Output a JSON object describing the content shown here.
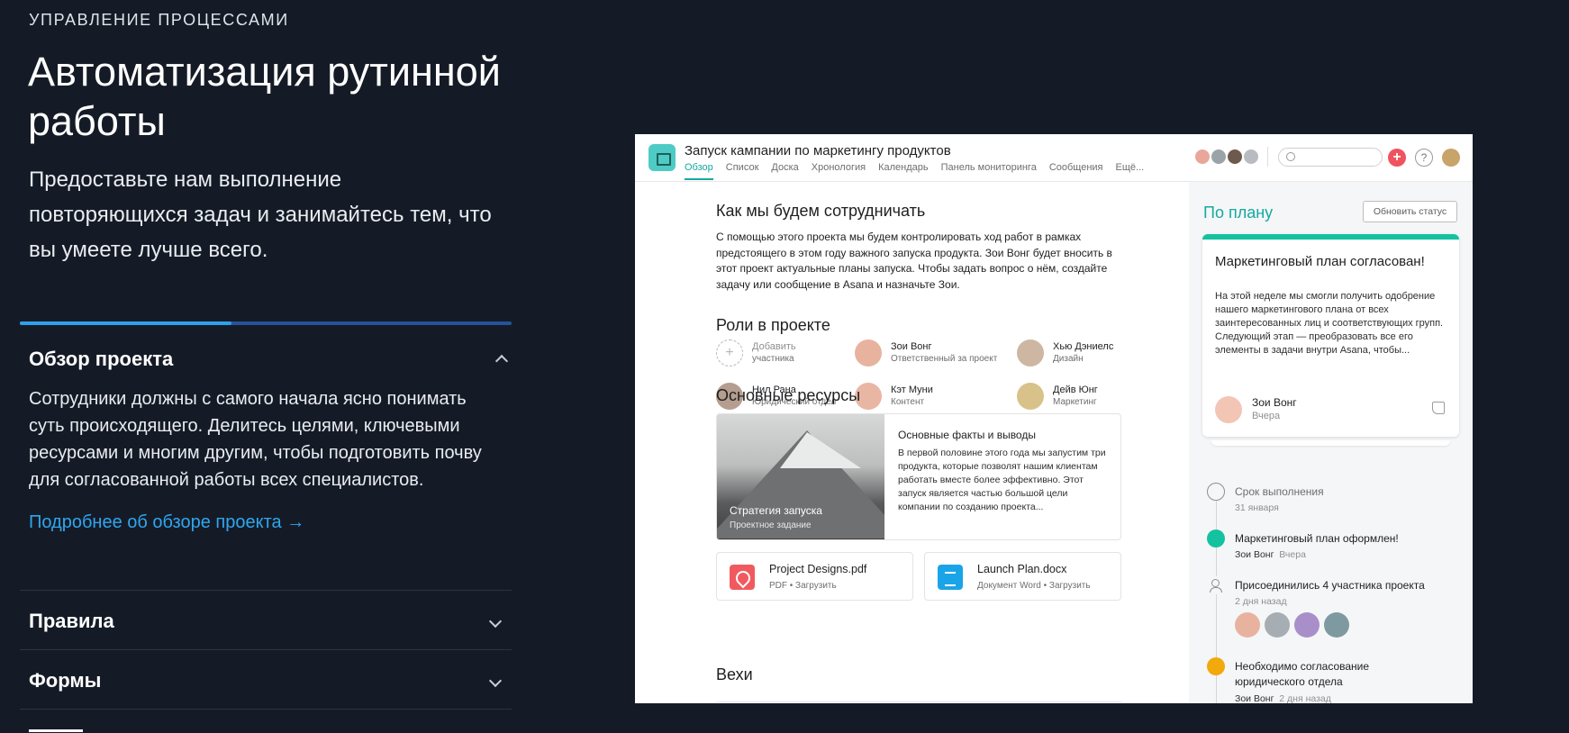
{
  "eyebrow": "УПРАВЛЕНИЕ ПРОЦЕССАМИ",
  "hero": {
    "title": "Автоматизация рутинной работы",
    "description": "Предоставьте нам выполнение повторяющихся задач и занимайтесь тем, что вы умеете лучше всего."
  },
  "progress": {
    "value": 0.43,
    "fill_color": "#2fa0ec",
    "track_color": "#25539a"
  },
  "accordion": {
    "open": {
      "title": "Обзор проекта",
      "body": "Сотрудники должны с самого начала ясно понимать суть происходящего. Делитесь целями, ключевыми ресурсами и многим другим, чтобы подготовить почву для согласованной работы всех специалистов.",
      "link": "Подробнее об обзоре проекта →"
    },
    "items": [
      {
        "title": "Правила"
      },
      {
        "title": "Формы"
      }
    ]
  },
  "app": {
    "project_title": "Запуск кампании по маркетингу продуктов",
    "tabs": [
      "Обзор",
      "Список",
      "Доска",
      "Хронология",
      "Календарь",
      "Панель мониторинга",
      "Сообщения",
      "Ещё..."
    ],
    "active_tab": "Обзор",
    "header_icons": [
      "search-icon",
      "plus-icon",
      "help-icon"
    ],
    "accent_color": "#14aaa0",
    "overview": {
      "heading": "Как мы будем сотрудничать",
      "text": "С помощью этого проекта мы будем контролировать ход работ в рамках предстоящего в этом году важного запуска продукта. Зои Вонг будет вносить в этот проект актуальные планы запуска. Чтобы задать вопрос о нём, создайте задачу или сообщение в Asana и назначьте Зои."
    },
    "roles": {
      "heading": "Роли в проекте",
      "add": {
        "name": "Добавить",
        "sub": "участника"
      },
      "people": [
        {
          "name": "Зои Вонг",
          "role": "Ответственный за проект"
        },
        {
          "name": "Хью Дэниелс",
          "role": "Дизайн"
        },
        {
          "name": "Нил Рана",
          "role": "Юридический отдел"
        },
        {
          "name": "Кэт Муни",
          "role": "Контент"
        },
        {
          "name": "Дейв Юнг",
          "role": "Маркетинг"
        }
      ]
    },
    "resources": {
      "heading": "Основные ресурсы",
      "brief": {
        "image_title": "Стратегия запуска",
        "image_sub": "Проектное задание",
        "title": "Основные факты и выводы",
        "body": "В первой половине этого года мы запустим три продукта, которые позволят нашим клиентам работать вместе более эффективно. Этот запуск является частью большой цели компании по созданию проекта..."
      },
      "files": [
        {
          "name": "Project Designs.pdf",
          "sub": "PDF • Загрузить"
        },
        {
          "name": "Launch Plan.docx",
          "sub": "Документ Word • Загрузить"
        }
      ]
    },
    "milestones_heading": "Вехи",
    "status": {
      "label": "По плану",
      "update_button": "Обновить статус",
      "card": {
        "title": "Маркетинговый план согласован!",
        "body": "На этой неделе мы смогли получить одобрение нашего маркетингового плана от всех заинтересованных лиц и соответствующих групп. Следующий этап — преобразовать все его элементы в задачи внутри Asana, чтобы...",
        "author": "Зои Вонг",
        "date": "Вчера"
      },
      "timeline": [
        {
          "title": "Срок выполнения",
          "sub": "31 января"
        },
        {
          "title": "Маркетинговый план оформлен!",
          "author": "Зои Вонг",
          "when": "Вчера"
        },
        {
          "title": "Присоединились 4 участника проекта",
          "sub": "2 дня назад"
        },
        {
          "title": "Необходимо согласование юридического отдела",
          "author": "Зои Вонг",
          "when": "2 дня назад"
        }
      ]
    }
  }
}
